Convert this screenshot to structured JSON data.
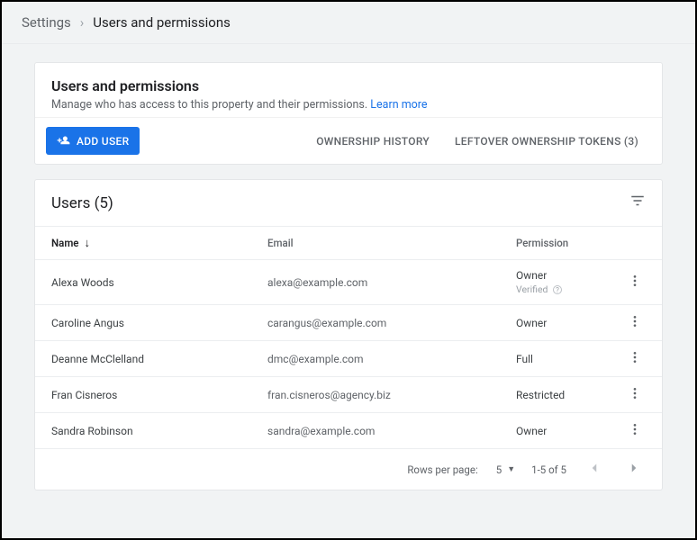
{
  "breadcrumb": {
    "root": "Settings",
    "current": "Users and permissions"
  },
  "heading": {
    "title": "Users and permissions",
    "subtitle": "Manage who has access to this property and their permissions.",
    "learn": "Learn more"
  },
  "toolbar": {
    "add_user": "ADD USER",
    "ownership_history": "OWNERSHIP HISTORY",
    "leftover_tokens": "LEFTOVER OWNERSHIP TOKENS (3)"
  },
  "users": {
    "section_title": "Users (5)",
    "columns": {
      "name": "Name",
      "email": "Email",
      "permission": "Permission"
    },
    "rows": [
      {
        "name": "Alexa Woods",
        "email": "alexa@example.com",
        "permission": "Owner",
        "permission_sub": "Verified"
      },
      {
        "name": "Caroline Angus",
        "email": "carangus@example.com",
        "permission": "Owner"
      },
      {
        "name": "Deanne McClelland",
        "email": "dmc@example.com",
        "permission": "Full"
      },
      {
        "name": "Fran Cisneros",
        "email": "fran.cisneros@agency.biz",
        "permission": "Restricted"
      },
      {
        "name": "Sandra Robinson",
        "email": "sandra@example.com",
        "permission": "Owner"
      }
    ]
  },
  "pager": {
    "rows_per_page_label": "Rows per page:",
    "rows_per_page_value": "5",
    "range": "1-5 of 5"
  }
}
